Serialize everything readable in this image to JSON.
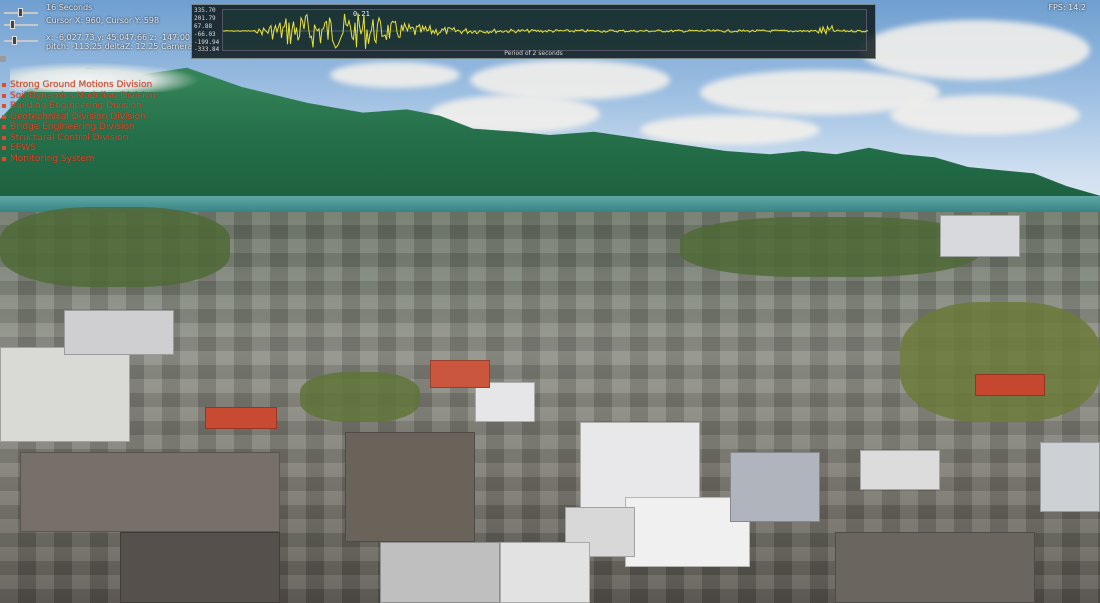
{
  "hud": {
    "duration_label": "16 Seconds",
    "cursor_label": "Cursor X: 960, Cursor Y: 598",
    "coords_line": "x: -6,027.73   y: 45,047.66   z: -147.00",
    "camera_line": "pitch: -113.25   deltaZ: 12.25   Camera Sp...",
    "fps_label": "FPS: 14.2"
  },
  "waveform": {
    "y_ticks": [
      "335.70",
      "201.79",
      "67.88",
      "-66.03",
      "-199.94",
      "-333.84"
    ],
    "peak_label": "0.21",
    "caption": "Period of 2 seconds",
    "line_color": "#e8e23a"
  },
  "menu": {
    "items": [
      "Strong Ground Motions Division",
      "Soil Dynamics Modeling Division",
      "Building Engineering Division",
      "Geotechnical Division Division",
      "Bridge Engineering Division",
      "Structural Control Division",
      "EEWS",
      "Monitoring System"
    ],
    "color": "#e14a2a"
  }
}
